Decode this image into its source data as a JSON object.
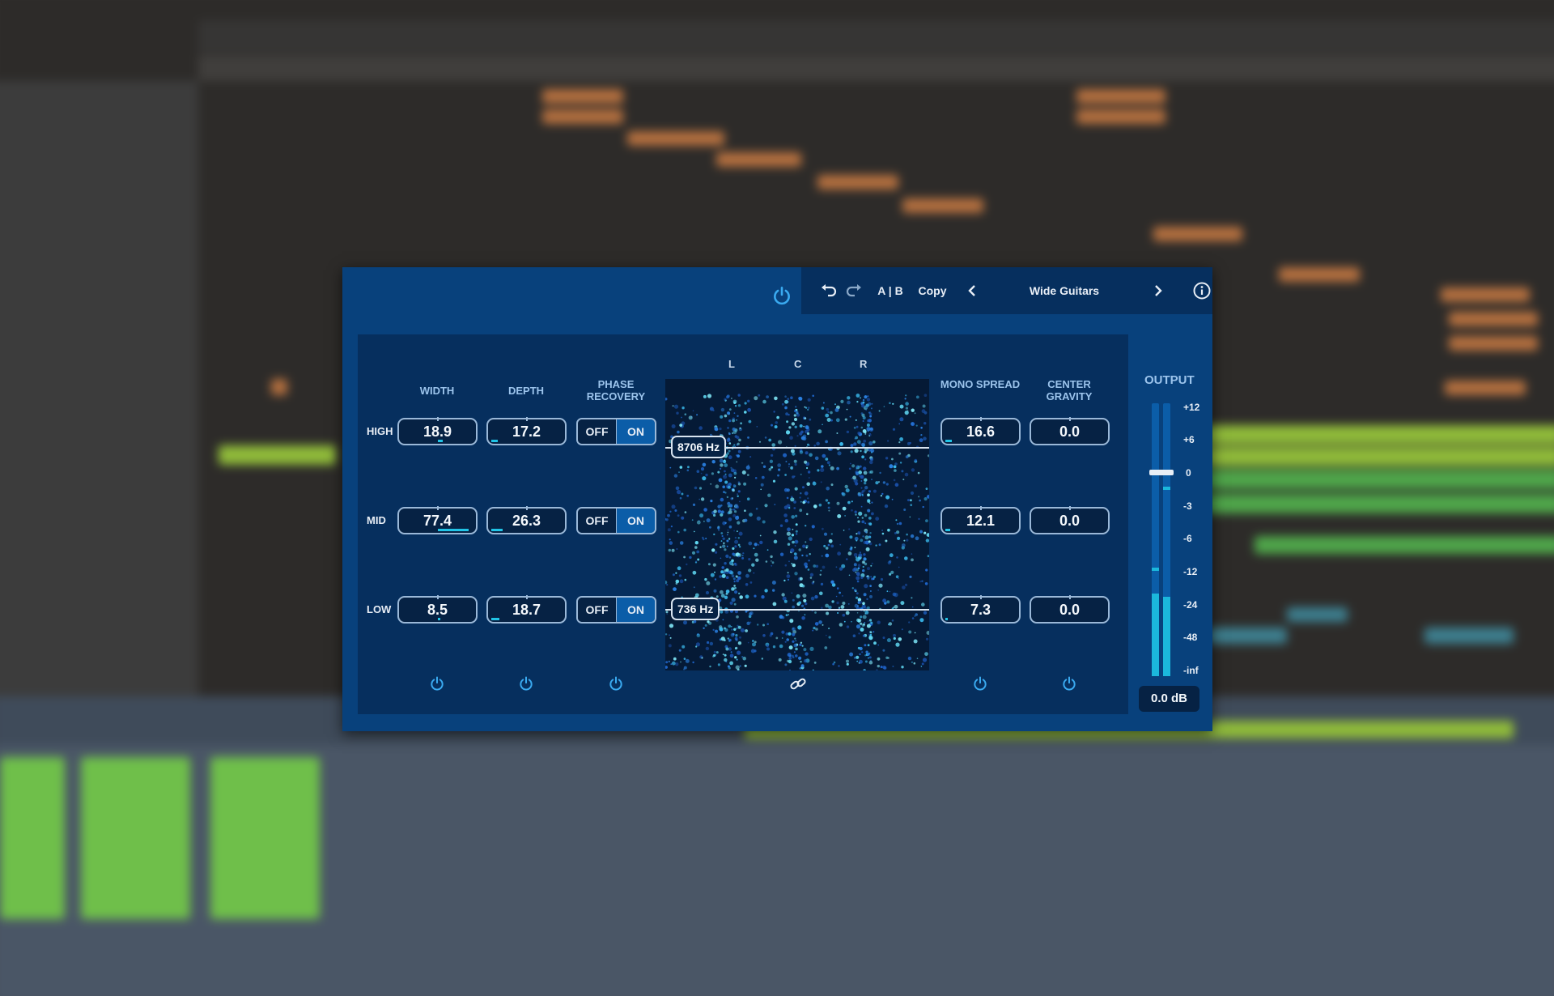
{
  "plugin": {
    "preset_name": "Wide Guitars",
    "ab_label": "A | B",
    "copy_label": "Copy",
    "columns": {
      "width": "WIDTH",
      "depth": "DEPTH",
      "phase_recovery": "PHASE RECOVERY",
      "mono_spread": "MONO SPREAD",
      "center_gravity": "CENTER GRAVITY"
    },
    "bands": {
      "high": {
        "label": "HIGH",
        "width": "18.9",
        "depth": "17.2",
        "phase_off": "OFF",
        "phase_on": "ON",
        "mono_spread": "16.6",
        "center_gravity": "0.0"
      },
      "mid": {
        "label": "MID",
        "width": "77.4",
        "depth": "26.3",
        "phase_off": "OFF",
        "phase_on": "ON",
        "mono_spread": "12.1",
        "center_gravity": "0.0"
      },
      "low": {
        "label": "LOW",
        "width": "8.5",
        "depth": "18.7",
        "phase_off": "OFF",
        "phase_on": "ON",
        "mono_spread": "7.3",
        "center_gravity": "0.0"
      }
    },
    "scope": {
      "left": "L",
      "center": "C",
      "right": "R",
      "high_crossover": "8706 Hz",
      "low_crossover": "736 Hz"
    },
    "output": {
      "label": "OUTPUT",
      "scale": [
        "+12",
        "+6",
        "0",
        "-3",
        "-6",
        "-12",
        "-24",
        "-48",
        "-inf"
      ],
      "gain_readout": "0.0 dB"
    },
    "colors": {
      "panel_bg": "#08417c",
      "accent": "#21c4e6",
      "value_text": "#f4f8fc"
    },
    "icons": {
      "power": "power-icon",
      "undo": "undo-icon",
      "redo": "redo-icon",
      "prev": "chevron-left-icon",
      "next": "chevron-right-icon",
      "info": "info-icon",
      "link": "link-icon"
    }
  }
}
